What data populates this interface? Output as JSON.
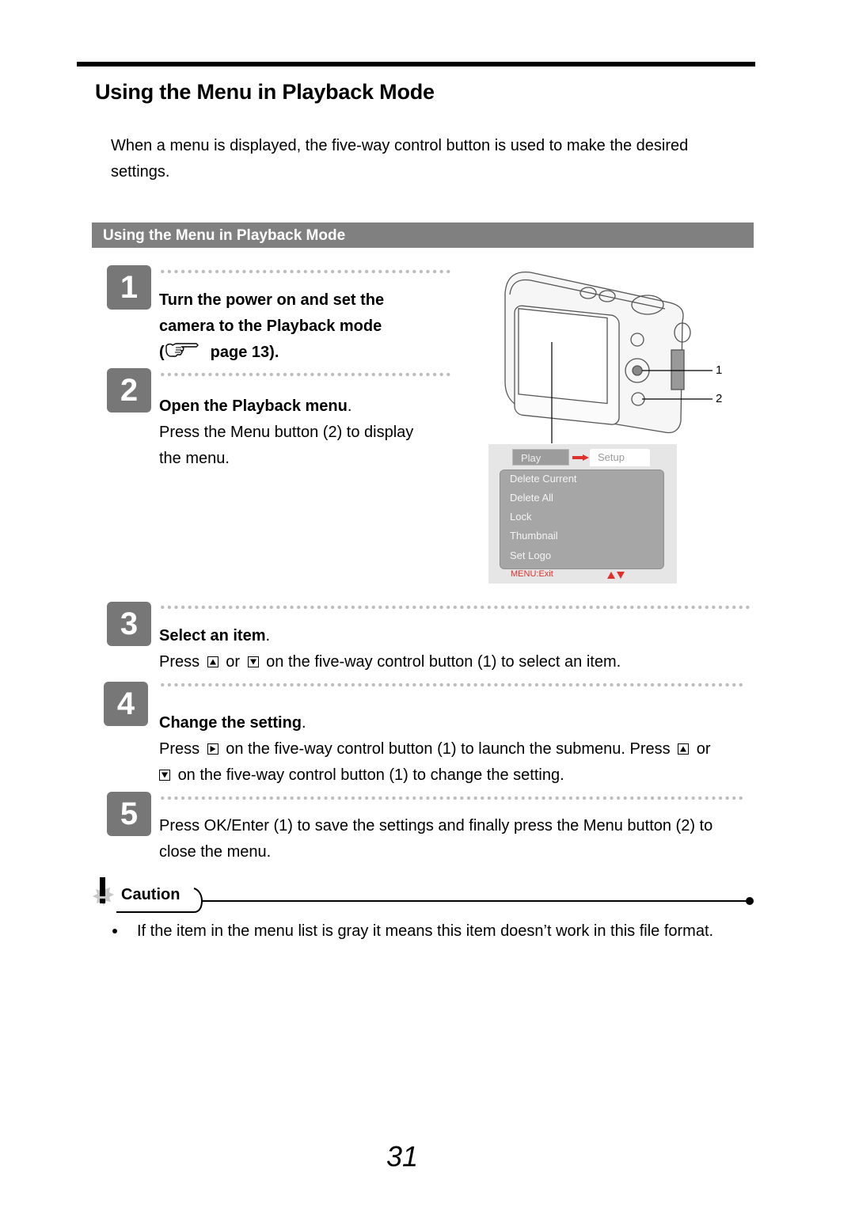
{
  "page_title": "Using the Menu in Playback Mode",
  "intro": "When a menu is displayed, the five-way control button is used to make the desired settings.",
  "section_bar": "Using the Menu in Playback Mode",
  "steps": [
    {
      "number": "1",
      "heading_line1": "Turn the power on and set the",
      "heading_line2": "camera to the Playback mode",
      "heading_open": "(",
      "heading_ref": "page 13).",
      "ref_icon": "pointing-hand-icon"
    },
    {
      "number": "2",
      "heading": "Open the Playback menu",
      "heading_suffix": ".",
      "text_line1": "Press the Menu button (2) to display",
      "text_line2": "the menu."
    },
    {
      "number": "3",
      "heading": "Select an item",
      "heading_suffix": ".",
      "text_a": "Press",
      "text_b": "or",
      "text_c": "on the five-way control button (1) to select an item."
    },
    {
      "number": "4",
      "heading": "Change the setting",
      "heading_suffix": ".",
      "text_a": "Press",
      "text_b": "on the five-way control button (1) to launch the submenu. Press",
      "text_c": "or",
      "text_d": "on the five-way control button (1) to change the setting."
    },
    {
      "number": "5",
      "text_line1": "Press OK/Enter (1) to save the settings and finally press the Menu button (2) to",
      "text_line2": "close the menu."
    }
  ],
  "camera_figure": {
    "callout_1": "1",
    "callout_2": "2",
    "menu": {
      "tab_active": "Play",
      "tab_inactive": "Setup",
      "items": [
        "Delete Current",
        "Delete All",
        "Lock",
        "Thumbnail",
        "Set Logo"
      ],
      "footer": "MENU:Exit",
      "accent_color": "#e0302e"
    }
  },
  "caution": {
    "label": "Caution",
    "bullets": [
      "If the item in the menu list is gray it means this item doesn’t work in this file format."
    ]
  },
  "page_number": "31"
}
